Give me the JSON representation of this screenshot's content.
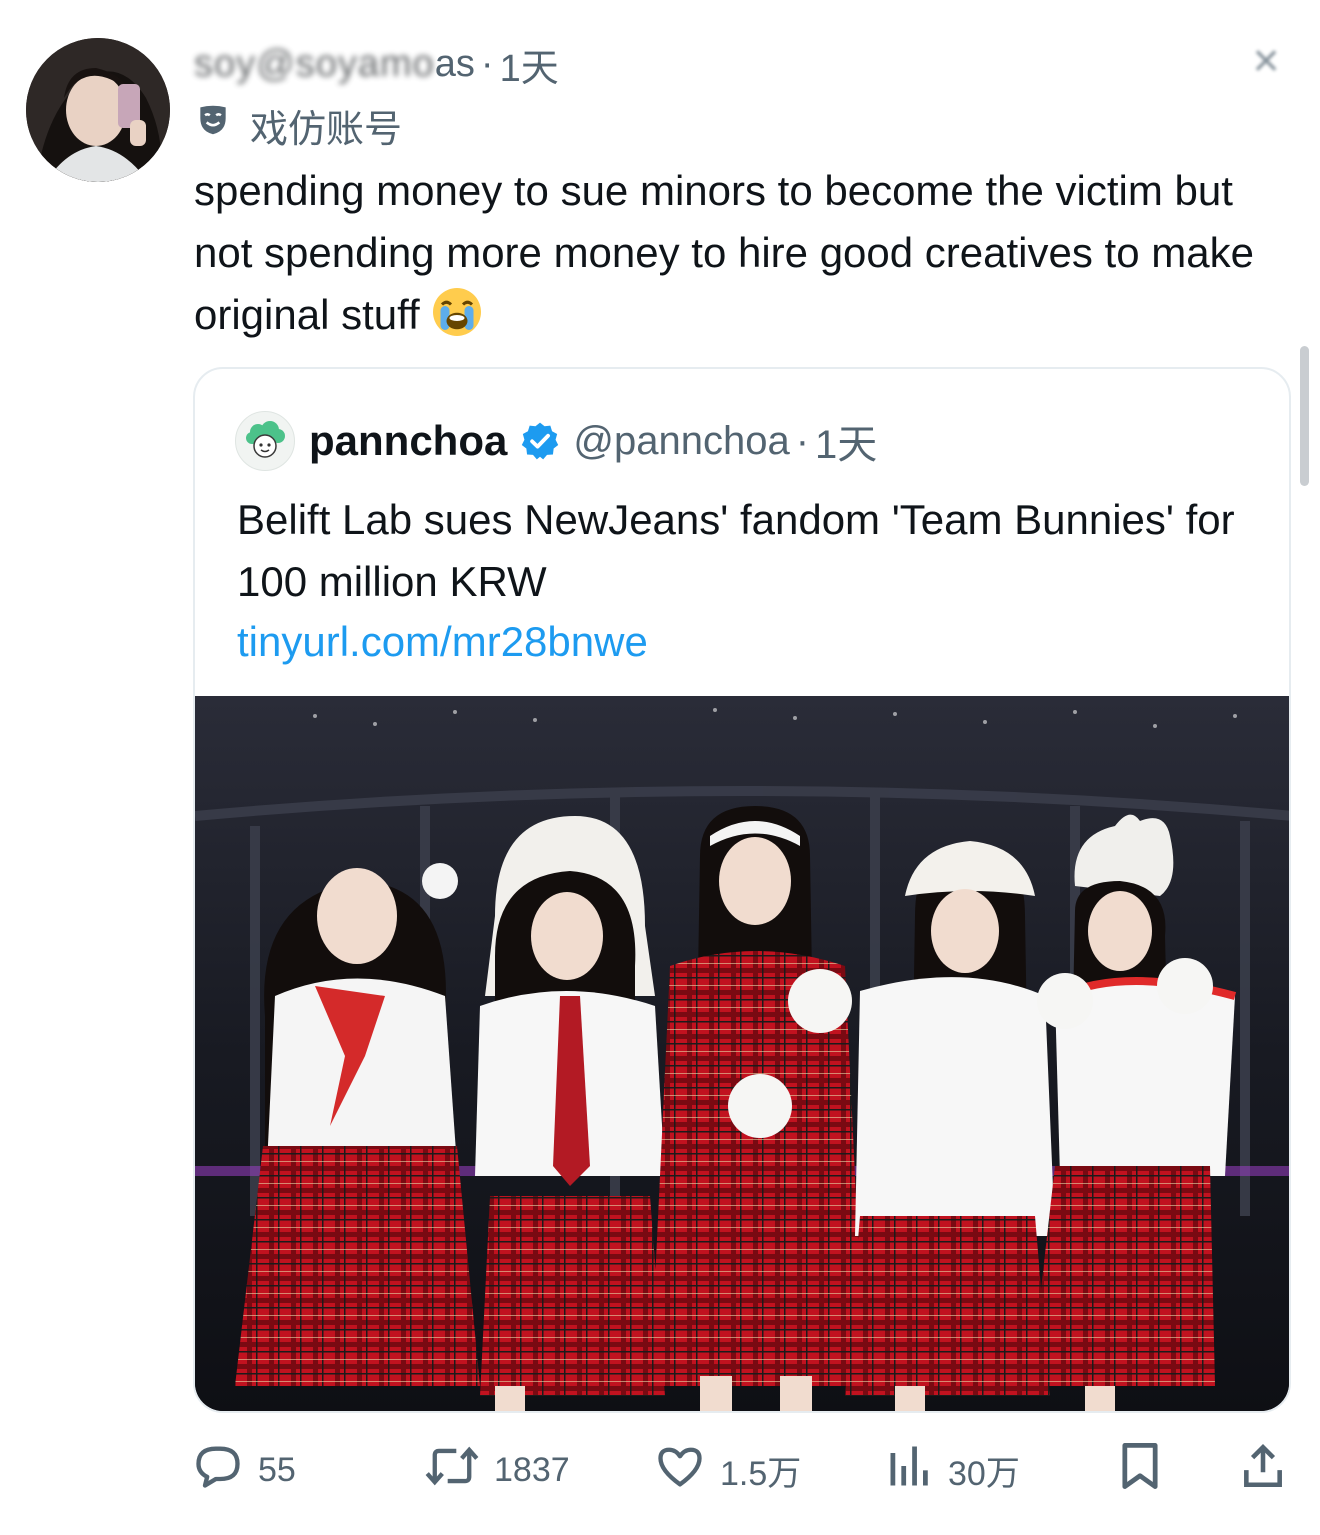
{
  "tweet": {
    "display_name_blurred": "soy",
    "handle_blurred": "@soyamo",
    "handle_tail": "as",
    "time": "1天",
    "account_label": "戏仿账号",
    "text": "spending money to sue minors to become the victim but not spending more money to hire good creatives to make original stuff",
    "emoji": "loudly-crying-face"
  },
  "quoted": {
    "name": "pannchoa",
    "handle": "@pannchoa",
    "time": "1天",
    "text": "Belift Lab sues NewJeans' fandom 'Team Bunnies' for 100 million KRW",
    "link": "tinyurl.com/mr28bnwe",
    "image_alt": "five-members-holiday-plaid-outfits-photo"
  },
  "actions": {
    "reply_count": "55",
    "repost_count": "1837",
    "like_count": "1.5万",
    "views_count": "30万"
  },
  "colors": {
    "text": "#0f1419",
    "secondary": "#536471",
    "link": "#1d9bf0",
    "border": "#e6ecf0",
    "verified": "#1d9bf0"
  }
}
